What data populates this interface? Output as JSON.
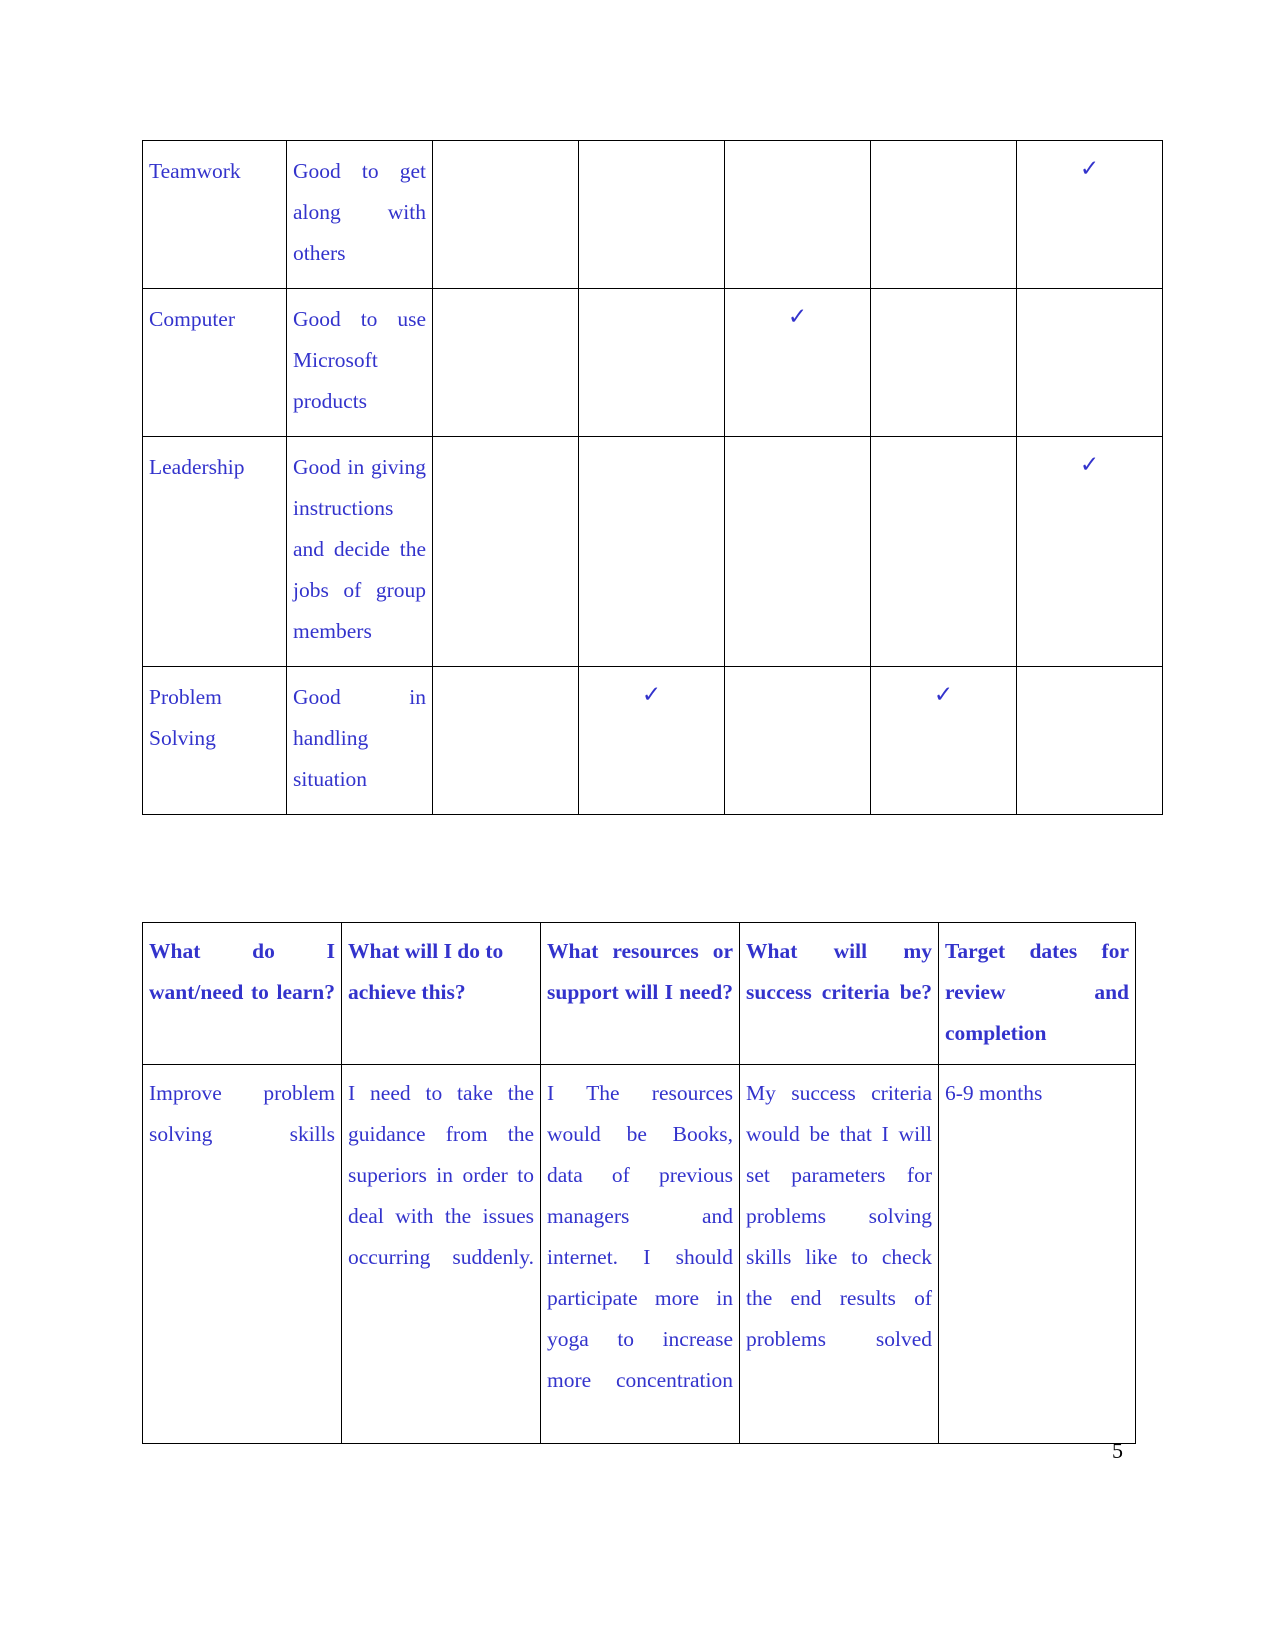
{
  "document": {
    "page_number": "5",
    "text_color": "#3333cc",
    "border_color": "#000000"
  },
  "skills_table": {
    "check_glyph": "✓",
    "num_rating_columns": 5,
    "rows": [
      {
        "skill": "Teamwork",
        "description": "Good to get along with others",
        "checks": [
          false,
          false,
          false,
          false,
          true
        ]
      },
      {
        "skill": "Computer",
        "description": "Good to use Microsoft products",
        "checks": [
          false,
          false,
          true,
          false,
          false
        ]
      },
      {
        "skill": "Leadership",
        "description": "Good in giving instructions and decide the jobs of group members",
        "checks": [
          false,
          false,
          false,
          false,
          true
        ]
      },
      {
        "skill": "Problem Solving",
        "description": "Good in handling situation",
        "checks": [
          false,
          true,
          false,
          true,
          false
        ]
      }
    ]
  },
  "plan_table": {
    "headers": [
      "What do I want/need to learn?",
      "What will I do to achieve this?",
      "What resources or support will I need?",
      "What will my success criteria be?",
      "Target dates for review and completion"
    ],
    "rows": [
      {
        "cells": [
          "Improve problem solving skills",
          "I need to take the guidance from the superiors in order to deal with the issues occurring suddenly.",
          "I The resources would be Books, data of previous managers and internet. I should participate more in yoga to increase more concentration",
          "My success criteria would be that I will set parameters for problems solving skills like to check the end results of problems solved",
          "6-9 months"
        ]
      }
    ]
  }
}
